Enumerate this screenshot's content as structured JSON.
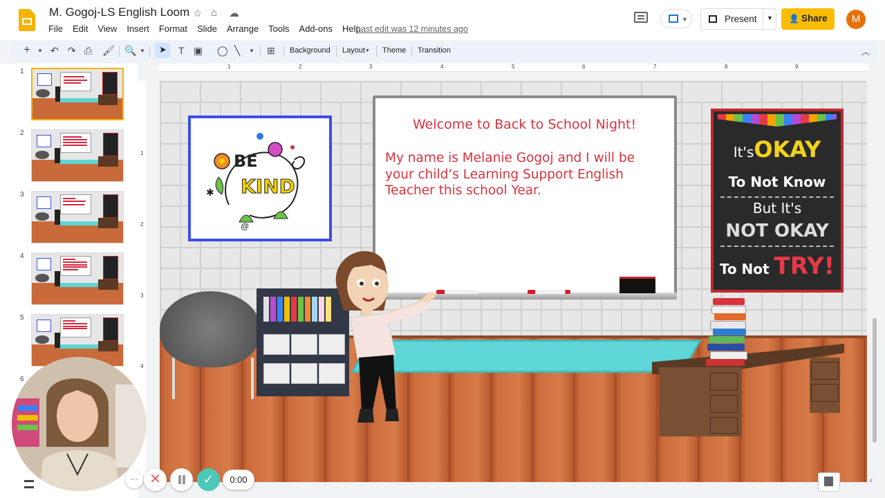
{
  "app": {
    "doc_title": "M. Gogoj-LS English Loom",
    "last_edit": "Last edit was 12 minutes ago",
    "avatar_initial": "M"
  },
  "menu": [
    "File",
    "Edit",
    "View",
    "Insert",
    "Format",
    "Slide",
    "Arrange",
    "Tools",
    "Add-ons",
    "Help"
  ],
  "header_buttons": {
    "present": "Present",
    "share": "Share"
  },
  "toolbar": {
    "background": "Background",
    "layout": "Layout",
    "theme": "Theme",
    "transition": "Transition"
  },
  "ruler": {
    "h": [
      "1",
      "2",
      "3",
      "4",
      "5",
      "6",
      "7",
      "8",
      "9"
    ],
    "v": [
      "1",
      "2",
      "3",
      "4"
    ]
  },
  "filmstrip": {
    "slides": [
      "1",
      "2",
      "3",
      "4",
      "5",
      "6"
    ]
  },
  "slide": {
    "welcome": "Welcome to Back to School Night!",
    "intro": "My name is Melanie Gogoj and I will be your child’s Learning Support English Teacher this school Year.",
    "bekind": {
      "line1": "BE",
      "line2": "KIND"
    },
    "poster": {
      "l1a": "It's",
      "l1b": "OKAY",
      "l2": "To Not Know",
      "l3": "But It's",
      "l4": "NOT OKAY",
      "l5a": "To Not",
      "l5b": "TRY!"
    }
  },
  "recording": {
    "timer": "0:00",
    "more": "···",
    "cancel": "✕",
    "done": "✓"
  },
  "colors": {
    "accent_red": "#d9323c",
    "share_yellow": "#fbbc04",
    "avatar_orange": "#e8710a",
    "frame_blue": "#3d4de6",
    "done_teal": "#4dc9b8"
  }
}
